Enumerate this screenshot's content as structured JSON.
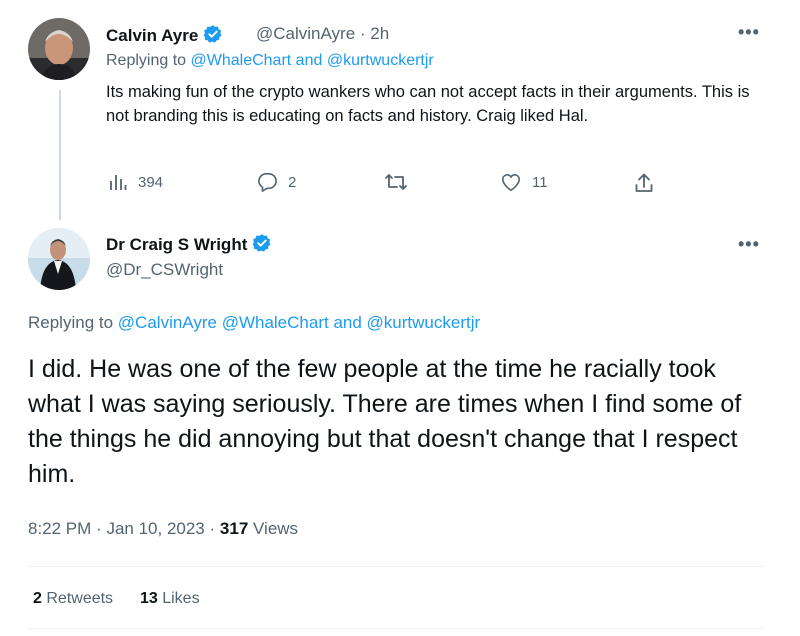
{
  "tweet1": {
    "display_name": "Calvin Ayre",
    "handle": "@CalvinAyre",
    "separator": "·",
    "time": "2h",
    "replying_prefix": "Replying to",
    "mention_a": "@WhaleChart",
    "and_word": "and",
    "mention_b": "@kurtwuckertjr",
    "text": "Its making fun of the crypto wankers who can not accept facts in their arguments. This is not branding this is educating on facts and history. Craig liked Hal.",
    "views_count": "394",
    "reply_count": "2",
    "retweet_count": "",
    "like_count": "11",
    "more_label": "•••"
  },
  "tweet2": {
    "display_name": "Dr Craig S Wright",
    "handle": "@Dr_CSWright",
    "replying_prefix": "Replying to",
    "mention_a": "@CalvinAyre",
    "mention_b": "@WhaleChart",
    "and_word": "and",
    "mention_c": "@kurtwuckertjr",
    "text": "I did. He was one of the few people at the time he racially took what I was saying seriously. There are times when I find some of the things he did annoying but that doesn't change that I respect him.",
    "time": "8:22 PM",
    "dot1": "·",
    "date": "Jan 10, 2023",
    "dot2": "·",
    "views_count": "317",
    "views_label": "Views",
    "retweets_count": "2",
    "retweets_label": "Retweets",
    "likes_count": "13",
    "likes_label": "Likes",
    "more_label": "•••"
  },
  "colors": {
    "accent": "#1d9bf0",
    "text": "#0f1419",
    "secondary": "#536471",
    "divider": "#eff3f4"
  },
  "icons": [
    "views-icon",
    "reply-icon",
    "retweet-icon",
    "like-icon",
    "share-icon",
    "verified-icon",
    "more-icon"
  ]
}
